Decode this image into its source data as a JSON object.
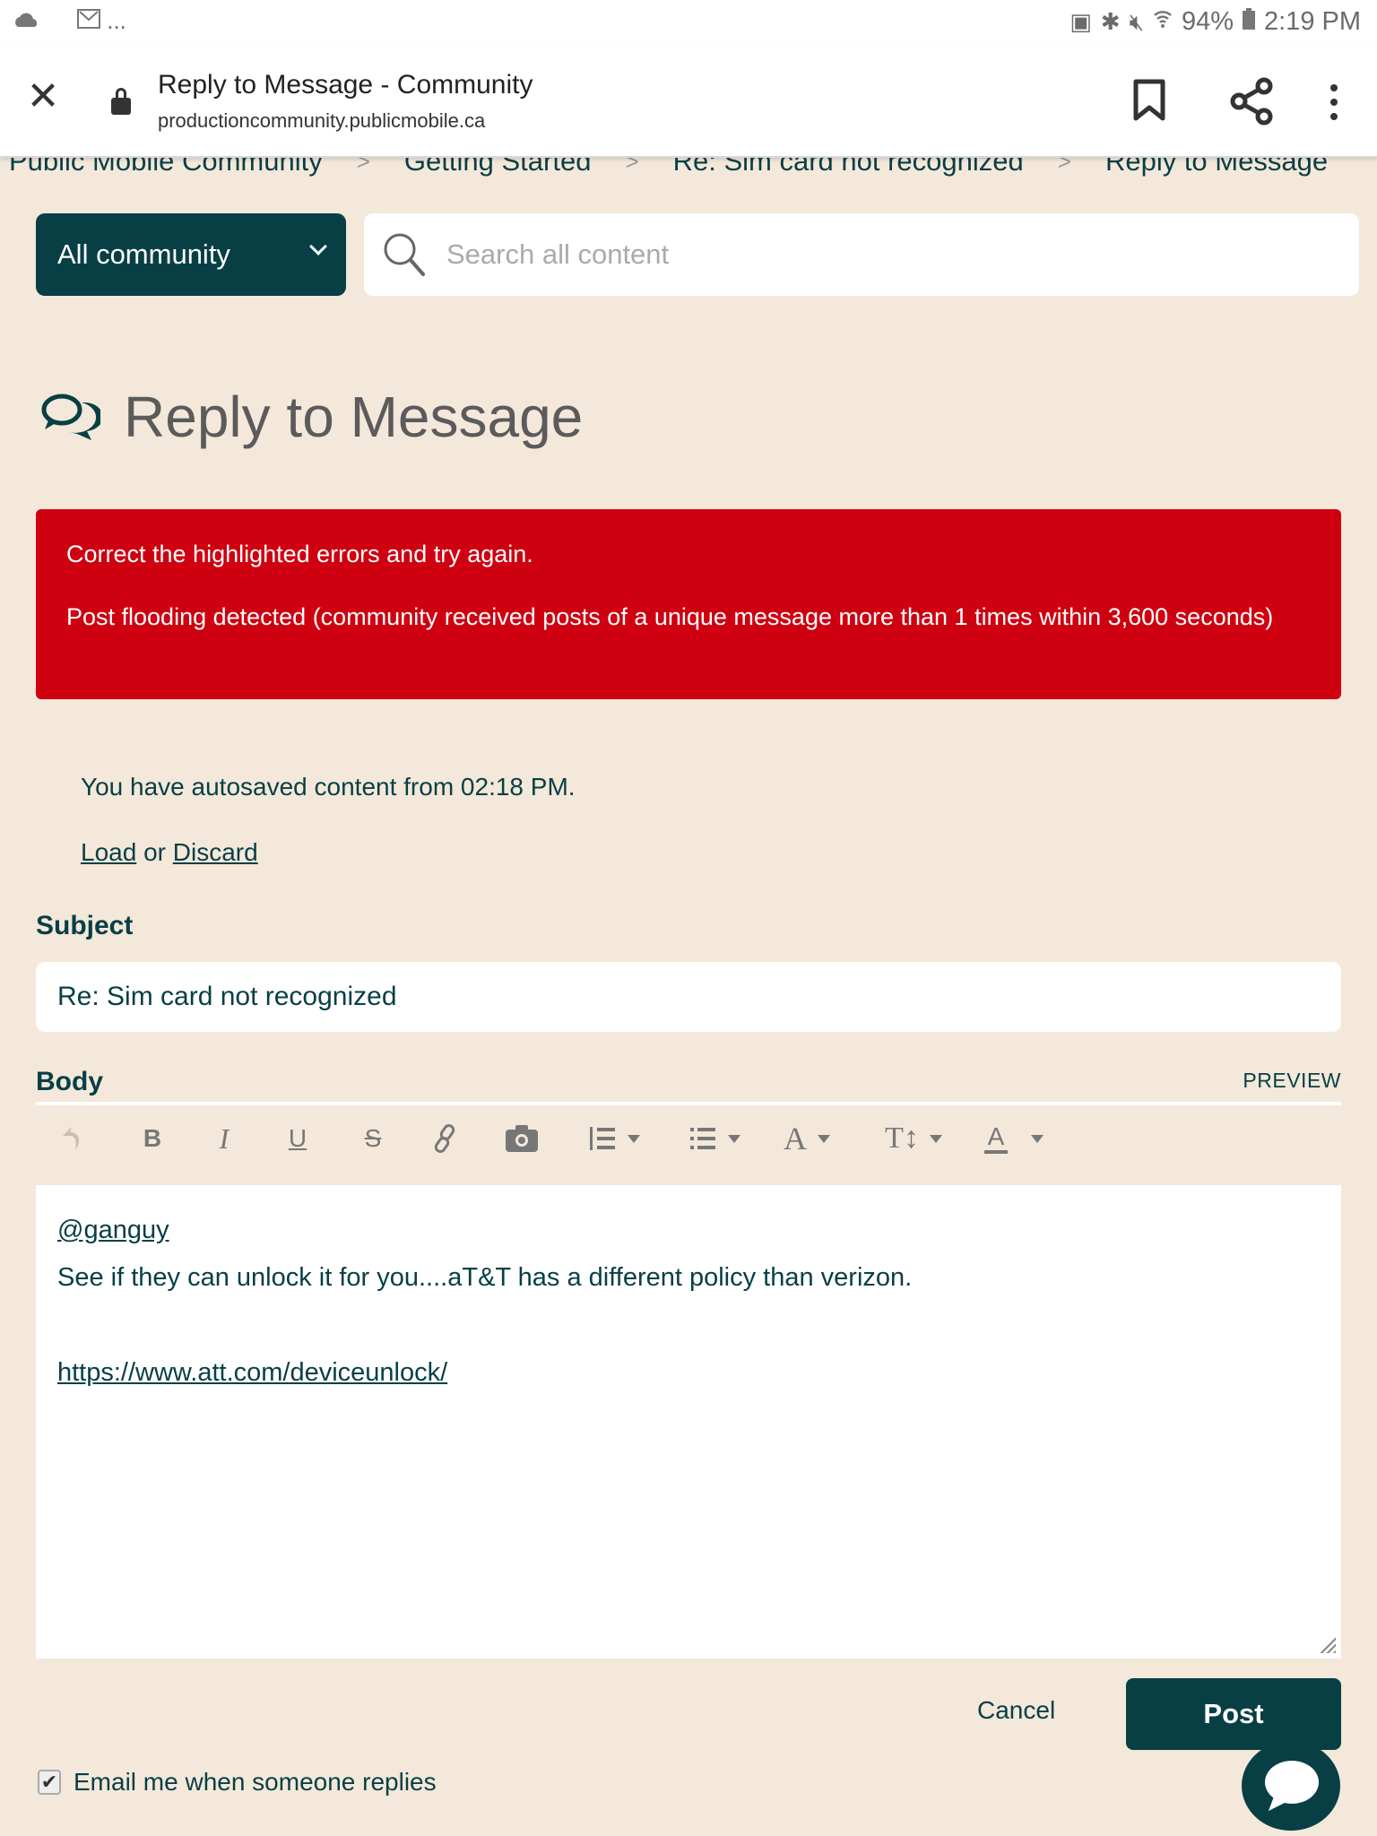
{
  "status_bar": {
    "left_icons": [
      "cloud-icon",
      "gmail-icon",
      "more-notifications-icon"
    ],
    "more_label": "...",
    "right_icons": [
      "battery-saver-icon",
      "bluetooth-icon",
      "mute-icon",
      "wifi-icon"
    ],
    "battery": "94%",
    "time": "2:19 PM"
  },
  "browser": {
    "page_title": "Reply to Message - Community",
    "url": "productioncommunity.publicmobile.ca"
  },
  "breadcrumb": [
    "Public Mobile Community",
    "Getting Started",
    "Re: Sim card not recognized",
    "Reply to Message"
  ],
  "breadcrumb_separator": ">",
  "search": {
    "scope_selected": "All community",
    "placeholder": "Search all content",
    "value": ""
  },
  "page": {
    "title": "Reply to Message"
  },
  "error": {
    "line1": "Correct the highlighted errors and try again.",
    "line2": "Post flooding detected (community received posts of a unique message more than 1 times within 3,600 seconds)"
  },
  "autosave": {
    "message": "You have autosaved content from 02:18 PM.",
    "load_label": "Load",
    "or_label": "or",
    "discard_label": "Discard"
  },
  "form": {
    "subject_label": "Subject",
    "subject_value": "Re: Sim card not recognized",
    "body_label": "Body",
    "preview_label": "PREVIEW",
    "toolbar": [
      {
        "name": "undo-icon",
        "glyph": "↶"
      },
      {
        "name": "bold-icon",
        "glyph": "B"
      },
      {
        "name": "italic-icon",
        "glyph": "I"
      },
      {
        "name": "underline-icon",
        "glyph": "U"
      },
      {
        "name": "strikethrough-icon",
        "glyph": "S"
      },
      {
        "name": "link-icon",
        "glyph": "🔗"
      },
      {
        "name": "camera-icon",
        "glyph": "📷"
      },
      {
        "name": "numbered-list-icon",
        "glyph": "☰"
      },
      {
        "name": "bullet-list-icon",
        "glyph": "☰"
      },
      {
        "name": "font-icon",
        "glyph": "A"
      },
      {
        "name": "font-size-icon",
        "glyph": "T↕"
      },
      {
        "name": "text-color-icon",
        "glyph": "A"
      }
    ],
    "body": {
      "mention": "@ganguy",
      "line1": "See if they can unlock it for you....aT&T has a different policy than verizon.",
      "link": "https://www.att.com/deviceunlock/"
    },
    "cancel_label": "Cancel",
    "post_label": "Post",
    "email_option_label": "Email me when someone replies",
    "email_option_checked": true
  },
  "colors": {
    "brand": "#073f45",
    "background": "#f3e8da",
    "error": "#cf0010"
  }
}
